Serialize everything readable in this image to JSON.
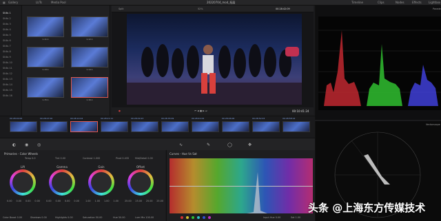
{
  "topbar": {
    "tabs": [
      "Gallery",
      "LUTs",
      "Media Pool"
    ],
    "project": "20220704_mod_拓展",
    "viewer_tab": "Split",
    "right_tabs": [
      "Timeline",
      "Clips",
      "Nodes",
      "Effects",
      "Lightbox"
    ],
    "scopes_title": "Parade",
    "timecode_top": "00:28:42:09"
  },
  "stills": {
    "header": "Stills 1",
    "rows": [
      "Stills 2",
      "Stills 3",
      "Stills 4",
      "Stills 5",
      "Stills 6",
      "Stills 7",
      "Stills 8",
      "Stills 9",
      "Stills 10",
      "Stills 11",
      "Stills 12",
      "Stills 13",
      "Stills 14",
      "Stills 15",
      "Stills 16"
    ],
    "thumbs": [
      "1.11.1",
      "1.12.1",
      "1.13.1",
      "1.14.1",
      "1.15.1",
      "1.16.1"
    ]
  },
  "viewer": {
    "timecode": "00:10:41:24",
    "zoom": "52%"
  },
  "clips": [
    {
      "tc": "00:28:00:00",
      "name": "01"
    },
    {
      "tc": "00:28:07:00",
      "name": "02"
    },
    {
      "tc": "00:28:14:04",
      "name": "03"
    },
    {
      "tc": "00:28:21:11",
      "name": "04"
    },
    {
      "tc": "00:28:29:23",
      "name": "05"
    },
    {
      "tc": "00:28:35:09",
      "name": "06"
    },
    {
      "tc": "00:28:41:02",
      "name": "07"
    },
    {
      "tc": "00:28:46:06",
      "name": "08"
    },
    {
      "tc": "00:28:52:03",
      "name": "09"
    },
    {
      "tc": "00:28:58:14",
      "name": "10"
    }
  ],
  "primaries": {
    "title": "Primaries - Color Wheels",
    "top_params": [
      "Temp 0.0",
      "Tint 0.00",
      "Contrast 1.000",
      "Pivot 0.435",
      "Mid/Detail 0.00"
    ],
    "wheels": [
      "Lift",
      "Gamma",
      "Gain",
      "Offset"
    ],
    "values": [
      [
        "0.00",
        "0.00",
        "0.00",
        "0.00"
      ],
      [
        "0.00",
        "0.00",
        "0.00",
        "0.00"
      ],
      [
        "1.00",
        "1.00",
        "1.00",
        "1.00"
      ],
      [
        "25.00",
        "25.00",
        "25.00",
        "25.00"
      ]
    ],
    "bottom_params": [
      "Color Boost 0.00",
      "Shadows 0.00",
      "Highlights 0.00",
      "Saturation 50.00",
      "Hue 50.00",
      "Lum Mix 100.00"
    ]
  },
  "curves": {
    "title": "Curves - Hue Vs Sat",
    "input_hue": "Input Hue 0.00",
    "sat": "Sat 1.00"
  },
  "vectorscope": {
    "title": "Vectorscope"
  },
  "watermark": "头条 @上海东方传媒技术"
}
